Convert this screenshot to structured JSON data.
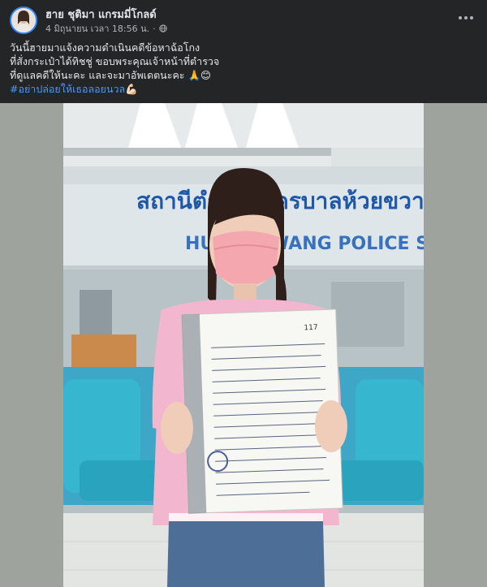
{
  "post": {
    "author": "ฮาย ชุติมา แกรมมี่โกลด์",
    "timestamp": "4 มิถุนายน เวลา 18:56 น.",
    "dot": "·",
    "lines": [
      "วันนี้ฮายมาแจ้งความดำเนินคดีข้อหาฉ้อโกง",
      "ที่สั่งกระเป๋าได้ทิชชู่  ขอบพระคุณเจ้าหน้าที่ตำรวจ",
      "ที่ดูแลคดีให้นะคะ และจะมาอัพเดตนะคะ 🙏😊"
    ],
    "hashtag": "#อย่าปล่อยให้เธอลอยนวล💪🏻"
  },
  "photo": {
    "sign_thai": "สถานีตำรวจนครบาลห้วยขวาง",
    "sign_english": "HUAI KHWANG POLICE STATION",
    "doc_number": "117"
  },
  "colors": {
    "header_bg": "#242526",
    "text": "#e4e6eb",
    "meta": "#b0b3b8",
    "hashtag": "#4599ff",
    "backdrop": "#9ea39d"
  }
}
